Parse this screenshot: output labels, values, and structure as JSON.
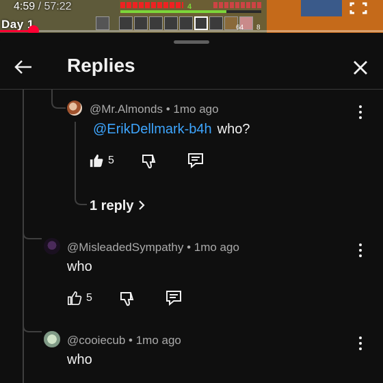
{
  "video": {
    "current_time": "4:59",
    "separator": " / ",
    "duration": "57:22",
    "chapter": "Day 1",
    "progress_fraction": 0.087,
    "hud": {
      "xp_level": "4",
      "slot_counts": [
        "64",
        "8"
      ]
    }
  },
  "panel": {
    "title": "Replies"
  },
  "comments": [
    {
      "author": "@Mr.Almonds",
      "time": "1mo ago",
      "mention": "@ErikDellmark-b4h",
      "text": "who?",
      "likes": "5",
      "replies_label": "1 reply"
    },
    {
      "author": "@MisleadedSympathy",
      "time": "1mo ago",
      "text": "who",
      "likes": "5"
    },
    {
      "author": "@cooiecub",
      "time": "1mo ago",
      "text": "who"
    }
  ],
  "meta_separator": " • ",
  "colors": {
    "background": "#0f0f0f",
    "mention": "#3ea6ff",
    "progress": "#ff0033",
    "secondary_text": "#aaaaaa"
  },
  "icons": [
    "fullscreen-icon",
    "back-arrow-icon",
    "close-icon",
    "like-icon",
    "dislike-icon",
    "reply-icon",
    "kebab-menu-icon",
    "chevron-right-icon"
  ]
}
